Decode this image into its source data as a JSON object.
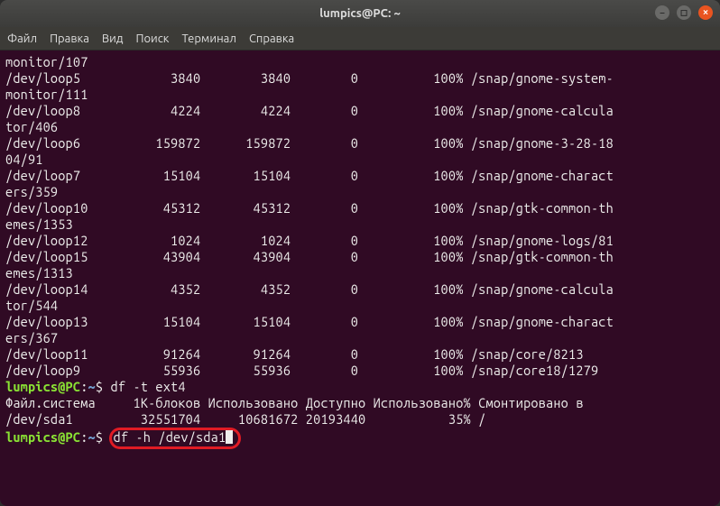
{
  "title": "lumpics@PC: ~",
  "menu": [
    "Файл",
    "Правка",
    "Вид",
    "Поиск",
    "Терминал",
    "Справка"
  ],
  "rows": [
    {
      "pre": "monitor/107"
    },
    {
      "fs": "/dev/loop5",
      "blocks": "3840",
      "used": "3840",
      "avail": "0",
      "pct": "100%",
      "mount": "/snap/gnome-system-"
    },
    {
      "pre": "monitor/111"
    },
    {
      "fs": "/dev/loop8",
      "blocks": "4224",
      "used": "4224",
      "avail": "0",
      "pct": "100%",
      "mount": "/snap/gnome-calcula"
    },
    {
      "pre": "tor/406"
    },
    {
      "fs": "/dev/loop6",
      "blocks": "159872",
      "used": "159872",
      "avail": "0",
      "pct": "100%",
      "mount": "/snap/gnome-3-28-18"
    },
    {
      "pre": "04/91"
    },
    {
      "fs": "/dev/loop7",
      "blocks": "15104",
      "used": "15104",
      "avail": "0",
      "pct": "100%",
      "mount": "/snap/gnome-charact"
    },
    {
      "pre": "ers/359"
    },
    {
      "fs": "/dev/loop10",
      "blocks": "45312",
      "used": "45312",
      "avail": "0",
      "pct": "100%",
      "mount": "/snap/gtk-common-th"
    },
    {
      "pre": "emes/1353"
    },
    {
      "fs": "/dev/loop12",
      "blocks": "1024",
      "used": "1024",
      "avail": "0",
      "pct": "100%",
      "mount": "/snap/gnome-logs/81"
    },
    {
      "fs": "/dev/loop15",
      "blocks": "43904",
      "used": "43904",
      "avail": "0",
      "pct": "100%",
      "mount": "/snap/gtk-common-th"
    },
    {
      "pre": "emes/1313"
    },
    {
      "fs": "/dev/loop14",
      "blocks": "4352",
      "used": "4352",
      "avail": "0",
      "pct": "100%",
      "mount": "/snap/gnome-calcula"
    },
    {
      "pre": "tor/544"
    },
    {
      "fs": "/dev/loop13",
      "blocks": "15104",
      "used": "15104",
      "avail": "0",
      "pct": "100%",
      "mount": "/snap/gnome-charact"
    },
    {
      "pre": "ers/367"
    },
    {
      "fs": "/dev/loop11",
      "blocks": "91264",
      "used": "91264",
      "avail": "0",
      "pct": "100%",
      "mount": "/snap/core/8213"
    },
    {
      "fs": "/dev/loop9",
      "blocks": "55936",
      "used": "55936",
      "avail": "0",
      "pct": "100%",
      "mount": "/snap/core18/1279"
    }
  ],
  "prompt1": {
    "user": "lumpics@PC",
    "sep": ":",
    "path": "~",
    "dollar": "$ ",
    "cmd": "df -t ext4"
  },
  "header": {
    "fs": "Файл.система",
    "blocks": "1K-блоков",
    "used": "Использовано",
    "avail": "Доступно",
    "pct": "Использовано%",
    "mount": "Смонтировано в"
  },
  "row2": {
    "fs": "/dev/sda1",
    "blocks": "32551704",
    "used": "10681672",
    "avail": "20193440",
    "pct": "35%",
    "mount": "/"
  },
  "prompt2": {
    "user": "lumpics@PC",
    "sep": ":",
    "path": "~",
    "dollar": "$ ",
    "cmd": "df -h /dev/sda1"
  }
}
